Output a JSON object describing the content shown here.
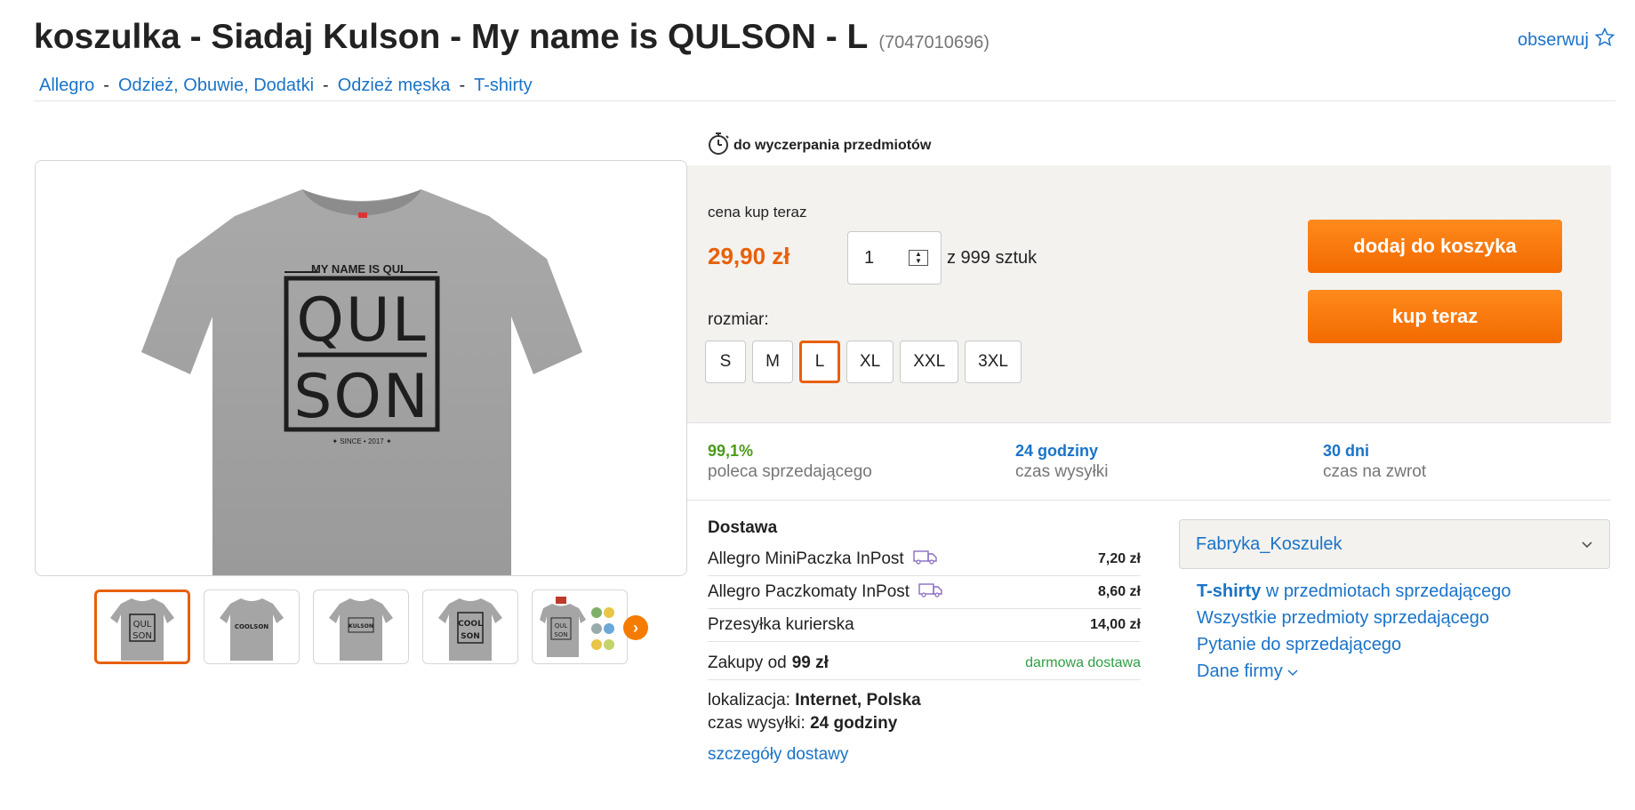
{
  "header": {
    "title": "koszulka - Siadaj Kulson - My name is QULSON - L",
    "offer_id": "(7047010696)",
    "follow_label": "obserwuj"
  },
  "breadcrumb": [
    {
      "label": "Allegro"
    },
    {
      "label": "Odzież, Obuwie, Dodatki"
    },
    {
      "label": "Odzież męska"
    },
    {
      "label": "T-shirty"
    }
  ],
  "breadcrumb_sep": "-",
  "product_image": {
    "print_top": "MY NAME IS QUL",
    "print_line1": "QUL",
    "print_line2": "SON",
    "print_bottom": "✦ SINCE • 2017 ✦"
  },
  "thumbnails": [
    {
      "caption1": "QUL",
      "caption2": "SON",
      "active": true
    },
    {
      "caption1": "COOLSON",
      "caption2": "",
      "active": false
    },
    {
      "caption1": "KULSON",
      "caption2": "",
      "active": false
    },
    {
      "caption1": "COOL",
      "caption2": "SON",
      "active": false
    },
    {
      "caption1": "QUL",
      "caption2": "SON",
      "active": false
    }
  ],
  "availability": {
    "text": "do wyczerpania przedmiotów"
  },
  "buy": {
    "price_label": "cena kup teraz",
    "price": "29,90 zł",
    "quantity": "1",
    "quantity_of": "z 999 sztuk",
    "size_label": "rozmiar:",
    "sizes": [
      "S",
      "M",
      "L",
      "XL",
      "XXL",
      "3XL"
    ],
    "selected_size": "L",
    "add_to_cart": "dodaj do koszyka",
    "buy_now": "kup teraz"
  },
  "stats": [
    {
      "value": "99,1%",
      "label": "poleca sprzedającego",
      "color": "#4b9b1b"
    },
    {
      "value": "24 godziny",
      "label": "czas wysyłki",
      "color": "#1a73c8"
    },
    {
      "value": "30 dni",
      "label": "czas na zwrot",
      "color": "#1a73c8"
    }
  ],
  "delivery": {
    "heading": "Dostawa",
    "options": [
      {
        "name": "Allegro MiniPaczka InPost",
        "price": "7,20 zł",
        "icon": "truck-return-icon"
      },
      {
        "name": "Allegro Paczkomaty InPost",
        "price": "8,60 zł",
        "icon": "truck-return-icon"
      },
      {
        "name": "Przesyłka kurierska",
        "price": "14,00 zł"
      }
    ],
    "free_prefix": "Zakupy od",
    "free_amount": "99 zł",
    "free_label": "darmowa dostawa",
    "location_label": "lokalizacja:",
    "location_value": "Internet, Polska",
    "ship_label": "czas wysyłki:",
    "ship_value": "24 godziny",
    "details_link": "szczegóły dostawy"
  },
  "seller": {
    "name": "Fabryka_Koszulek",
    "link1_bold": "T-shirty",
    "link1_rest": "w przedmiotach sprzedającego",
    "link2": "Wszystkie przedmioty sprzedającego",
    "link3": "Pytanie do sprzedającego",
    "link4": "Dane firmy"
  },
  "colors": {
    "accent": "#e8600a",
    "link": "#1a73c8",
    "free_delivery": "#2f9e44"
  }
}
